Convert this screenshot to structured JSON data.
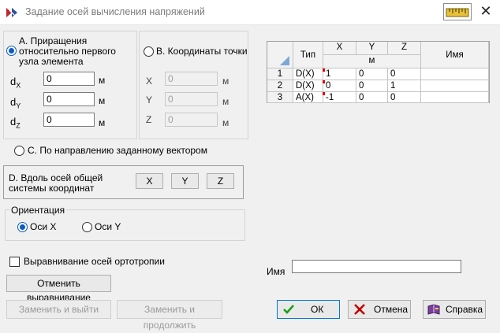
{
  "window": {
    "title": "Задание осей вычисления напряжений"
  },
  "option_a": {
    "label_line1": "А. Приращения",
    "label_line2": "относительно первого",
    "label_line3": "узла элемента",
    "selected": true,
    "fields": [
      {
        "name": "d",
        "sub": "X",
        "value": "0",
        "unit": "м"
      },
      {
        "name": "d",
        "sub": "Y",
        "value": "0",
        "unit": "м"
      },
      {
        "name": "d",
        "sub": "Z",
        "value": "0",
        "unit": "м"
      }
    ]
  },
  "option_b": {
    "label": "В. Координаты точки",
    "selected": false,
    "fields": [
      {
        "name": "X",
        "value": "0",
        "unit": "м"
      },
      {
        "name": "Y",
        "value": "0",
        "unit": "м"
      },
      {
        "name": "Z",
        "value": "0",
        "unit": "м"
      }
    ]
  },
  "option_c": {
    "label": "С. По направлению заданному вектором",
    "selected": false
  },
  "option_d": {
    "label_line1": "D. Вдоль осей общей",
    "label_line2": "системы координат",
    "buttons": [
      "X",
      "Y",
      "Z"
    ]
  },
  "orientation": {
    "legend": "Ориентация",
    "options": [
      {
        "label": "Оси X",
        "selected": true
      },
      {
        "label": "Оси Y",
        "selected": false
      }
    ]
  },
  "ortho_align": {
    "label": "Выравнивание осей ортотропии",
    "checked": false
  },
  "cancel_align_label": "Отменить выравнивание",
  "name_field": {
    "label": "Имя",
    "value": ""
  },
  "table": {
    "headers": {
      "type": "Тип",
      "x": "X",
      "y": "Y",
      "z": "Z",
      "unit": "м",
      "name": "Имя"
    },
    "rows": [
      {
        "num": "1",
        "type": "D(X)",
        "x": "1",
        "y": "0",
        "z": "0",
        "name": ""
      },
      {
        "num": "2",
        "type": "D(X)",
        "x": "0",
        "y": "0",
        "z": "1",
        "name": ""
      },
      {
        "num": "3",
        "type": "A(X)",
        "x": "-1",
        "y": "0",
        "z": "0",
        "name": ""
      }
    ]
  },
  "buttons": {
    "replace_exit": "Заменить и выйти",
    "replace_continue": "Заменить и продолжить",
    "ok": "ОК",
    "cancel": "Отмена",
    "help": "Справка"
  },
  "colors": {
    "accent": "#0a5cc5",
    "ok_check": "#1a9e1a",
    "cancel_x": "#c00000"
  }
}
